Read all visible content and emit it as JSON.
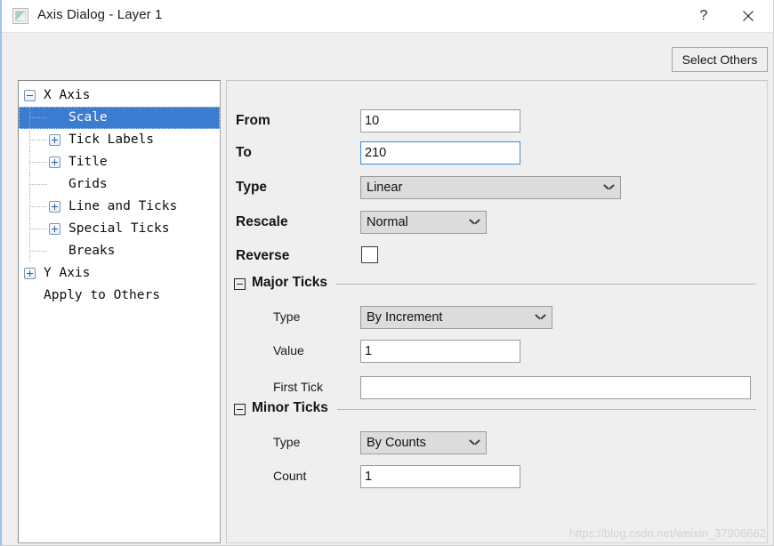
{
  "window": {
    "title": "Axis Dialog - Layer 1",
    "icon": "layer-image-icon",
    "help_label": "?",
    "close_label": "✕"
  },
  "toolbar": {
    "select_others_label": "Select Others"
  },
  "tree": {
    "items": [
      {
        "label": "X Axis",
        "level": 0,
        "expander": "minus",
        "selected": false
      },
      {
        "label": "Scale",
        "level": 1,
        "expander": "none",
        "selected": true
      },
      {
        "label": "Tick Labels",
        "level": 1,
        "expander": "plus",
        "selected": false
      },
      {
        "label": "Title",
        "level": 1,
        "expander": "plus",
        "selected": false
      },
      {
        "label": "Grids",
        "level": 1,
        "expander": "none",
        "selected": false
      },
      {
        "label": "Line and Ticks",
        "level": 1,
        "expander": "plus",
        "selected": false
      },
      {
        "label": "Special Ticks",
        "level": 1,
        "expander": "plus",
        "selected": false
      },
      {
        "label": "Breaks",
        "level": 1,
        "expander": "none",
        "selected": false
      },
      {
        "label": "Y Axis",
        "level": 0,
        "expander": "plus",
        "selected": false
      },
      {
        "label": "Apply to Others",
        "level": 0,
        "expander": "none",
        "selected": false
      }
    ]
  },
  "form": {
    "from": {
      "label": "From",
      "value": "10",
      "focused": false
    },
    "to": {
      "label": "To",
      "value": "210",
      "focused": true
    },
    "type": {
      "label": "Type",
      "value": "Linear"
    },
    "rescale": {
      "label": "Rescale",
      "value": "Normal"
    },
    "reverse": {
      "label": "Reverse",
      "checked": false
    }
  },
  "major_ticks": {
    "section_label": "Major Ticks",
    "type": {
      "label": "Type",
      "value": "By Increment"
    },
    "value": {
      "label": "Value",
      "value": "1"
    },
    "first_tick": {
      "label": "First Tick",
      "value": "",
      "placeholder": ""
    }
  },
  "minor_ticks": {
    "section_label": "Minor Ticks",
    "type": {
      "label": "Type",
      "value": "By Counts"
    },
    "count": {
      "label": "Count",
      "value": "1"
    }
  },
  "watermark": {
    "text": "https://blog.csdn.net/weixin_37906662"
  },
  "colors": {
    "selection_blue": "#3b7bd0",
    "focus_border": "#3f8cd8",
    "panel_bg": "#efefef",
    "tree_filler": "#808080",
    "combo_bg": "#dcdcdc"
  }
}
